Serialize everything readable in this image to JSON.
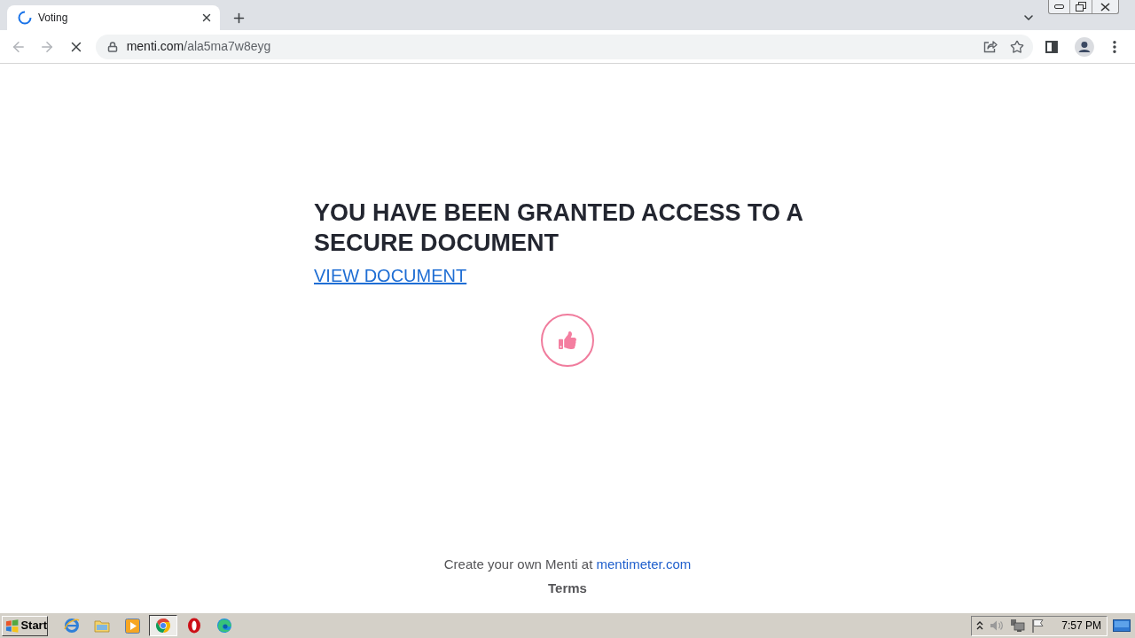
{
  "browser": {
    "tab": {
      "title": "Voting",
      "loading": true
    },
    "address": {
      "domain": "menti.com",
      "path": "/ala5ma7w8eyg"
    }
  },
  "page": {
    "heading": "YOU HAVE BEEN GRANTED ACCESS TO A SECURE DOCUMENT",
    "link": "VIEW DOCUMENT",
    "footer": {
      "text": "Create your own Menti at ",
      "link": "mentimeter.com"
    },
    "terms": "Terms"
  },
  "taskbar": {
    "start": "Start",
    "apps": [
      {
        "kind": "ie",
        "selected": false
      },
      {
        "kind": "explorer",
        "selected": false
      },
      {
        "kind": "media",
        "selected": false
      },
      {
        "kind": "chrome",
        "selected": true
      },
      {
        "kind": "opera",
        "selected": false
      },
      {
        "kind": "edge",
        "selected": false
      }
    ],
    "clock": "7:57 PM"
  }
}
